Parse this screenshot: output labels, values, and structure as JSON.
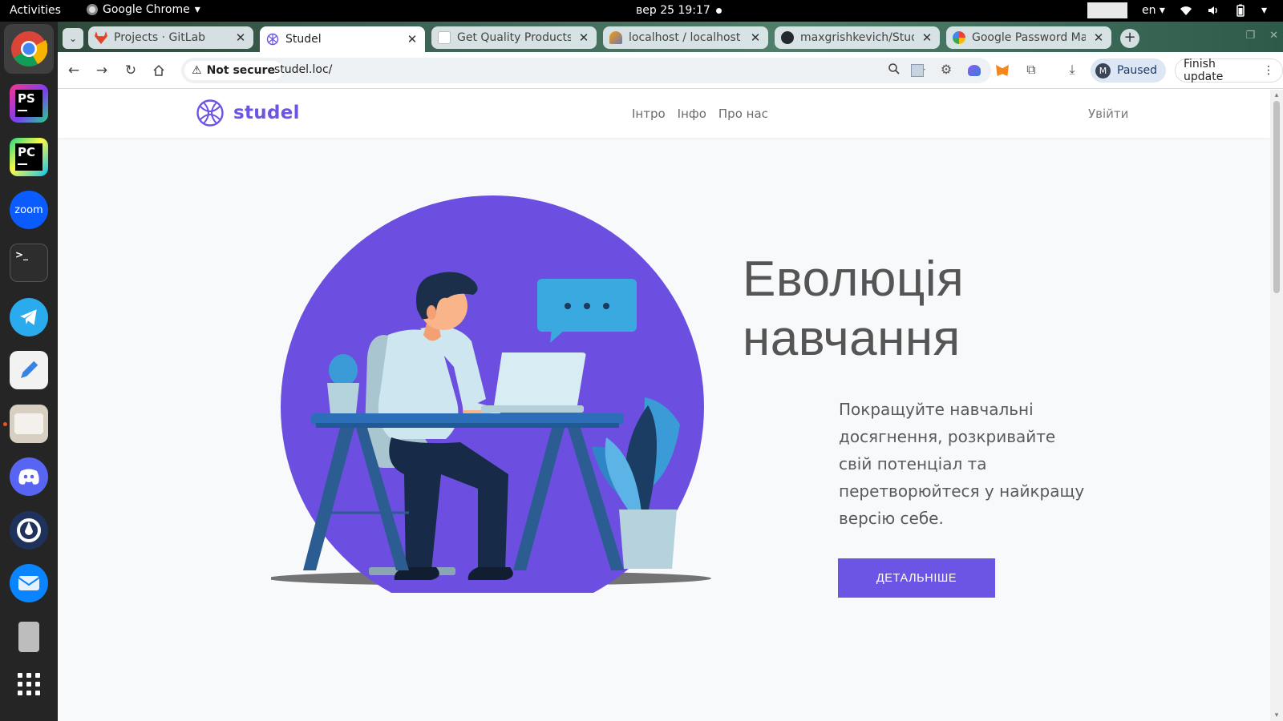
{
  "system_bar": {
    "activities": "Activities",
    "app_name": "Google Chrome",
    "clock": "вер 25  19:17",
    "lang": "en"
  },
  "dock": {
    "apps": [
      "google-chrome",
      "phpstorm",
      "pycharm",
      "zoom",
      "terminal",
      "telegram",
      "text-editor",
      "files",
      "discord",
      "mattermost",
      "thunderbird",
      "usb-drive",
      "app-grid"
    ],
    "ps_label": "PS",
    "pc_label": "PC",
    "zoom_label": "zoom"
  },
  "browser": {
    "tabs": [
      {
        "title": "Projects · GitLab",
        "active": false
      },
      {
        "title": "Studel",
        "active": true
      },
      {
        "title": "Get Quality Products",
        "active": false
      },
      {
        "title": "localhost / localhost",
        "active": false
      },
      {
        "title": "maxgrishkevich/Stud",
        "active": false
      },
      {
        "title": "Google Password Ma",
        "active": false
      }
    ],
    "security_label": "Not secure",
    "url": "studel.loc/",
    "profile_initial": "M",
    "profile_status": "Paused",
    "finish_update": "Finish update"
  },
  "site": {
    "brand": "studel",
    "nav": [
      "Інтро",
      "Інфо",
      "Про нас"
    ],
    "login": "Увійти",
    "hero_title_line1": "Еволюція",
    "hero_title_line2": "навчання",
    "hero_subtitle": "Покращуйте навчальні досягнення, розкривайте свій потенціал та перетворюйтеся у найкращу версію себе.",
    "cta": "ДЕТАЛЬНІШЕ"
  },
  "colors": {
    "brand": "#6c55e4",
    "desk": "#2c6fb8",
    "text": "#555555"
  }
}
